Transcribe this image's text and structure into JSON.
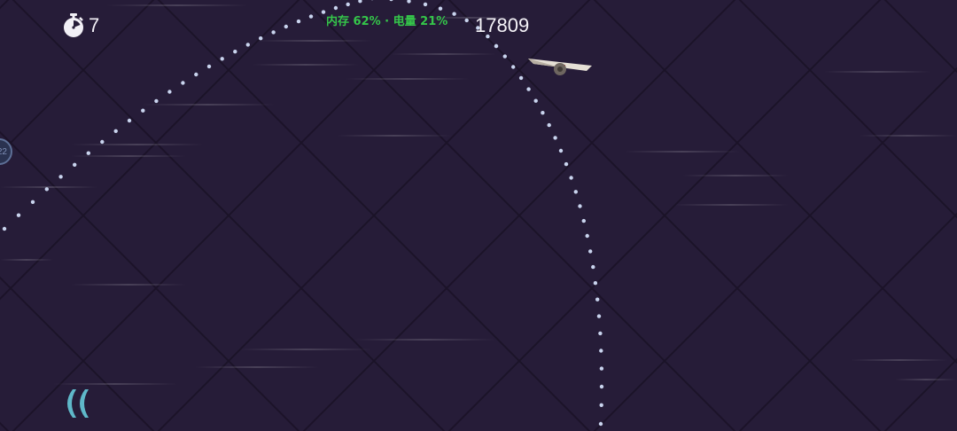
{
  "hud": {
    "timer_icon": "stopwatch-icon",
    "timer_count": "7",
    "status_text": "内存 62% · 电量 21%",
    "score": "17809"
  },
  "edge_marker": {
    "label": "22"
  },
  "controls": {
    "back_icon": "double-chevron-left-icon"
  },
  "colors": {
    "background": "#261c38",
    "grid_lines": "#1b1328",
    "trajectory_dots": "#c9d4ee",
    "status_text": "#35c64a",
    "back_button": "#5fb8c9",
    "score_text": "#f5f3f8"
  },
  "player": {
    "icon": "glider-plane-icon"
  }
}
